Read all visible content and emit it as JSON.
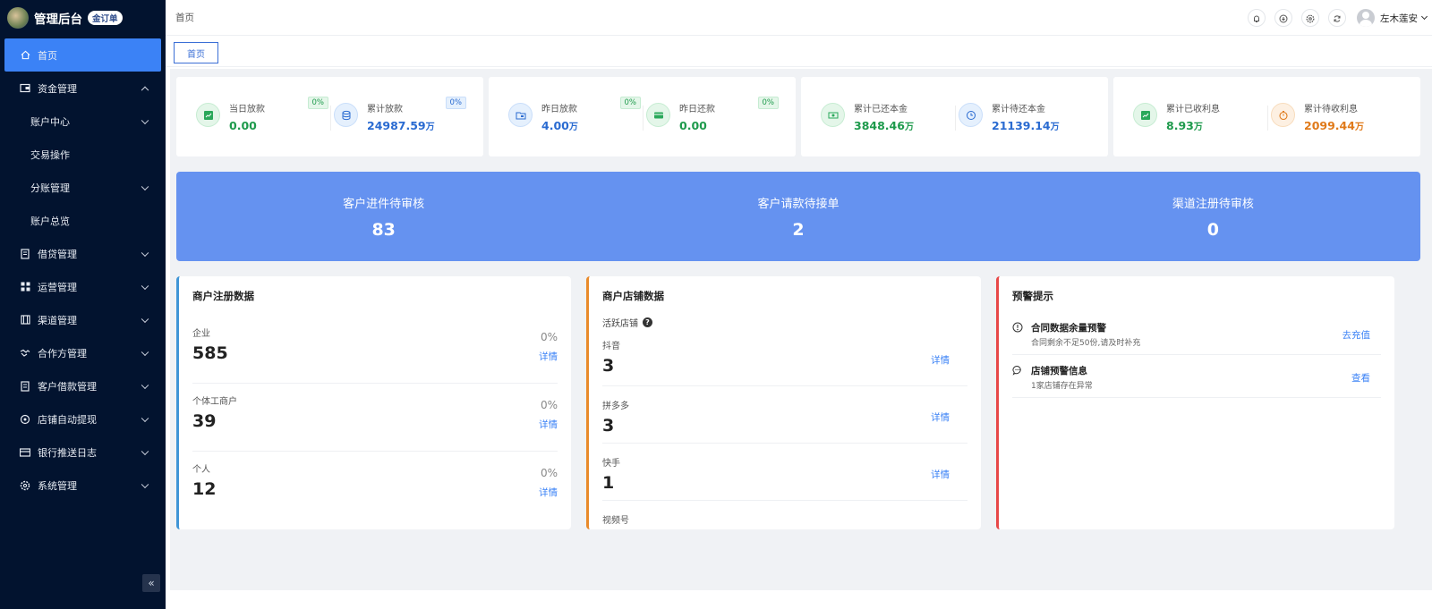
{
  "app": {
    "title": "管理后台",
    "badge": "金订单"
  },
  "sidebar": {
    "items": [
      {
        "label": "首页",
        "icon": "home-icon"
      },
      {
        "label": "资金管理",
        "icon": "wallet-icon"
      },
      {
        "label": "账户中心"
      },
      {
        "label": "交易操作"
      },
      {
        "label": "分账管理"
      },
      {
        "label": "账户总览"
      },
      {
        "label": "借贷管理",
        "icon": "document-icon"
      },
      {
        "label": "运营管理",
        "icon": "grid-icon"
      },
      {
        "label": "渠道管理",
        "icon": "film-icon"
      },
      {
        "label": "合作方管理",
        "icon": "handshake-icon"
      },
      {
        "label": "客户借款管理",
        "icon": "list-icon"
      },
      {
        "label": "店铺自动提现",
        "icon": "gear-circle-icon"
      },
      {
        "label": "银行推送日志",
        "icon": "card-icon"
      },
      {
        "label": "系统管理",
        "icon": "settings-icon"
      }
    ],
    "collapse_glyph": "«"
  },
  "header": {
    "breadcrumb": "首页",
    "user_name": "左木莲安"
  },
  "tabs": [
    {
      "label": "首页"
    }
  ],
  "stats": [
    {
      "label": "当日放款",
      "value": "0.00",
      "unit": "",
      "pct": "0%"
    },
    {
      "label": "累计放款",
      "value": "24987.59",
      "unit": "万",
      "pct": "0%"
    },
    {
      "label": "昨日放款",
      "value": "4.00",
      "unit": "万",
      "pct": "0%"
    },
    {
      "label": "昨日还款",
      "value": "0.00",
      "unit": "",
      "pct": "0%"
    },
    {
      "label": "累计已还本金",
      "value": "3848.46",
      "unit": "万"
    },
    {
      "label": "累计待还本金",
      "value": "21139.14",
      "unit": "万"
    },
    {
      "label": "累计已收利息",
      "value": "8.93",
      "unit": "万"
    },
    {
      "label": "累计待收利息",
      "value": "2099.44",
      "unit": "万"
    }
  ],
  "banner": [
    {
      "label": "客户进件待审核",
      "value": "83"
    },
    {
      "label": "客户请款待接单",
      "value": "2"
    },
    {
      "label": "渠道注册待审核",
      "value": "0"
    }
  ],
  "merchant_reg": {
    "title": "商户注册数据",
    "rows": [
      {
        "label": "企业",
        "value": "585",
        "pct": "0%",
        "link": "详情"
      },
      {
        "label": "个体工商户",
        "value": "39",
        "pct": "0%",
        "link": "详情"
      },
      {
        "label": "个人",
        "value": "12",
        "pct": "0%",
        "link": "详情"
      }
    ]
  },
  "merchant_store": {
    "title": "商户店铺数据",
    "subtitle": "活跃店铺",
    "help": "?",
    "rows": [
      {
        "label": "抖音",
        "value": "3",
        "link": "详情"
      },
      {
        "label": "拼多多",
        "value": "3",
        "link": "详情"
      },
      {
        "label": "快手",
        "value": "1",
        "link": "详情"
      }
    ],
    "last_label": "视频号"
  },
  "warnings": {
    "title": "预警提示",
    "rows": [
      {
        "title": "合同数据余量预警",
        "desc": "合同剩余不足50份,请及时补充",
        "action": "去充值"
      },
      {
        "title": "店铺预警信息",
        "desc": "1家店铺存在异常",
        "action": "查看"
      }
    ]
  },
  "colors": {
    "sidebar_bg": "#02132f",
    "accent": "#3b82f6",
    "banner_bg": "#6592f0",
    "green": "#1e9a4c",
    "orange": "#e07a1a"
  }
}
